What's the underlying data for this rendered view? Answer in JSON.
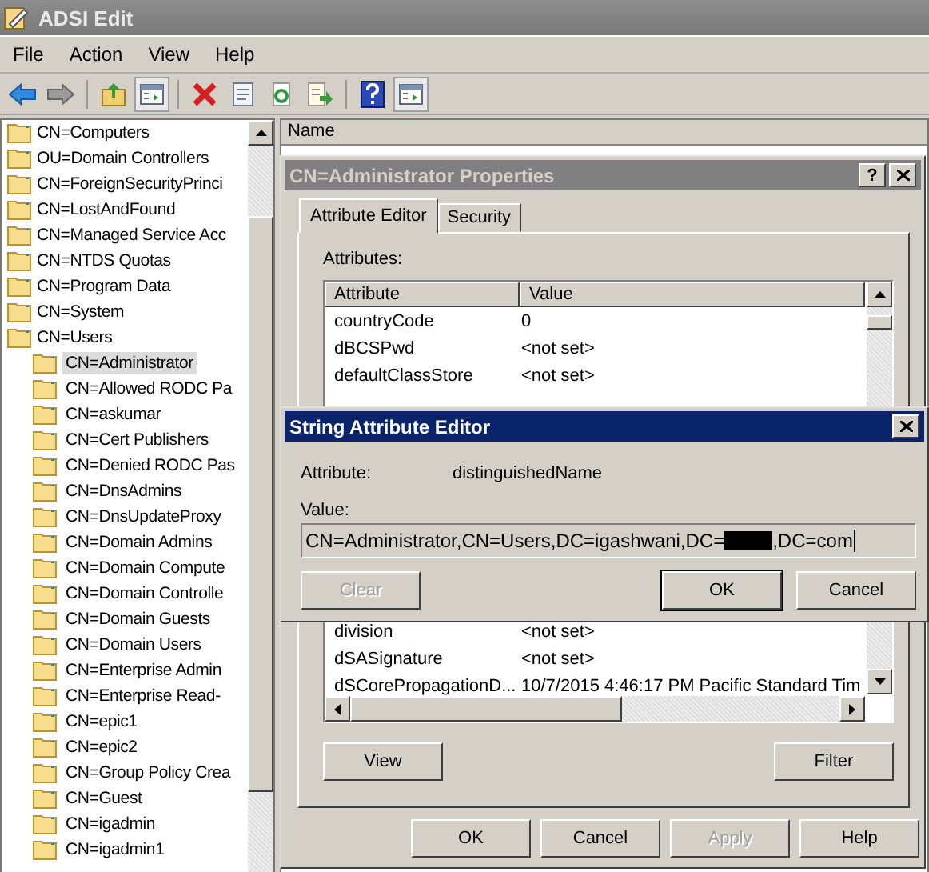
{
  "window": {
    "title": "ADSI Edit"
  },
  "menu": [
    "File",
    "Action",
    "View",
    "Help"
  ],
  "toolbar": [
    {
      "kind": "back",
      "pressed": false
    },
    {
      "kind": "forward",
      "pressed": false
    },
    {
      "kind": "separator"
    },
    {
      "kind": "up",
      "pressed": false
    },
    {
      "kind": "tree",
      "pressed": true
    },
    {
      "kind": "separator"
    },
    {
      "kind": "delete",
      "pressed": false
    },
    {
      "kind": "properties",
      "pressed": false
    },
    {
      "kind": "refresh",
      "pressed": false
    },
    {
      "kind": "export",
      "pressed": false
    },
    {
      "kind": "separator"
    },
    {
      "kind": "help",
      "pressed": false
    },
    {
      "kind": "actionpane",
      "pressed": true
    }
  ],
  "tree": {
    "items": [
      {
        "label": "CN=Computers",
        "selected": false
      },
      {
        "label": "OU=Domain Controllers",
        "selected": false
      },
      {
        "label": "CN=ForeignSecurityPrinci",
        "selected": false
      },
      {
        "label": "CN=LostAndFound",
        "selected": false
      },
      {
        "label": "CN=Managed Service Acc",
        "selected": false
      },
      {
        "label": "CN=NTDS Quotas",
        "selected": false
      },
      {
        "label": "CN=Program Data",
        "selected": false
      },
      {
        "label": "CN=System",
        "selected": false
      },
      {
        "label": "CN=Users",
        "selected": false,
        "children": [
          {
            "label": "CN=Administrator",
            "selected": true
          },
          {
            "label": "CN=Allowed RODC Pa",
            "selected": false
          },
          {
            "label": "CN=askumar",
            "selected": false
          },
          {
            "label": "CN=Cert Publishers",
            "selected": false
          },
          {
            "label": "CN=Denied RODC Pas",
            "selected": false
          },
          {
            "label": "CN=DnsAdmins",
            "selected": false
          },
          {
            "label": "CN=DnsUpdateProxy",
            "selected": false
          },
          {
            "label": "CN=Domain Admins",
            "selected": false
          },
          {
            "label": "CN=Domain Compute",
            "selected": false
          },
          {
            "label": "CN=Domain Controlle",
            "selected": false
          },
          {
            "label": "CN=Domain Guests",
            "selected": false
          },
          {
            "label": "CN=Domain Users",
            "selected": false
          },
          {
            "label": "CN=Enterprise Admin",
            "selected": false
          },
          {
            "label": "CN=Enterprise Read-",
            "selected": false
          },
          {
            "label": "CN=epic1",
            "selected": false
          },
          {
            "label": "CN=epic2",
            "selected": false
          },
          {
            "label": "CN=Group Policy Crea",
            "selected": false
          },
          {
            "label": "CN=Guest",
            "selected": false
          },
          {
            "label": "CN=igadmin",
            "selected": false
          },
          {
            "label": "CN=igadmin1",
            "selected": false
          }
        ]
      }
    ]
  },
  "details": {
    "columns": [
      "Name"
    ]
  },
  "properties_dialog": {
    "title": "CN=Administrator Properties",
    "help_button": "?",
    "tabs": [
      {
        "label": "Attribute Editor",
        "selected": true
      },
      {
        "label": "Security",
        "selected": false
      }
    ],
    "attributes_label": "Attributes:",
    "columns": [
      "Attribute",
      "Value"
    ],
    "rows_above": [
      {
        "attribute": "countryCode",
        "value": "0"
      },
      {
        "attribute": "dBCSPwd",
        "value": "<not set>"
      },
      {
        "attribute": "defaultClassStore",
        "value": "<not set>"
      }
    ],
    "rows_below": [
      {
        "attribute": "division",
        "value": "<not set>"
      },
      {
        "attribute": "dSASignature",
        "value": "<not set>"
      },
      {
        "attribute": "dSCorePropagationD...",
        "value": "10/7/2015 4:46:17 PM Pacific Standard Tim"
      }
    ],
    "list_buttons": [
      "View",
      "Filter"
    ],
    "footer_buttons": [
      {
        "label": "OK",
        "disabled": false
      },
      {
        "label": "Cancel",
        "disabled": false
      },
      {
        "label": "Apply",
        "disabled": true
      },
      {
        "label": "Help",
        "disabled": false
      }
    ]
  },
  "string_editor": {
    "title": "String Attribute Editor",
    "attribute_label": "Attribute:",
    "attribute": "distinguishedName",
    "value_label": "Value:",
    "value_before": "CN=Administrator,CN=Users,DC=igashwani,DC=",
    "value_after": ",DC=com",
    "buttons": [
      {
        "label": "Clear",
        "disabled": true,
        "default": false
      },
      {
        "label": "OK",
        "disabled": false,
        "default": true
      },
      {
        "label": "Cancel",
        "disabled": false,
        "default": false
      }
    ]
  }
}
